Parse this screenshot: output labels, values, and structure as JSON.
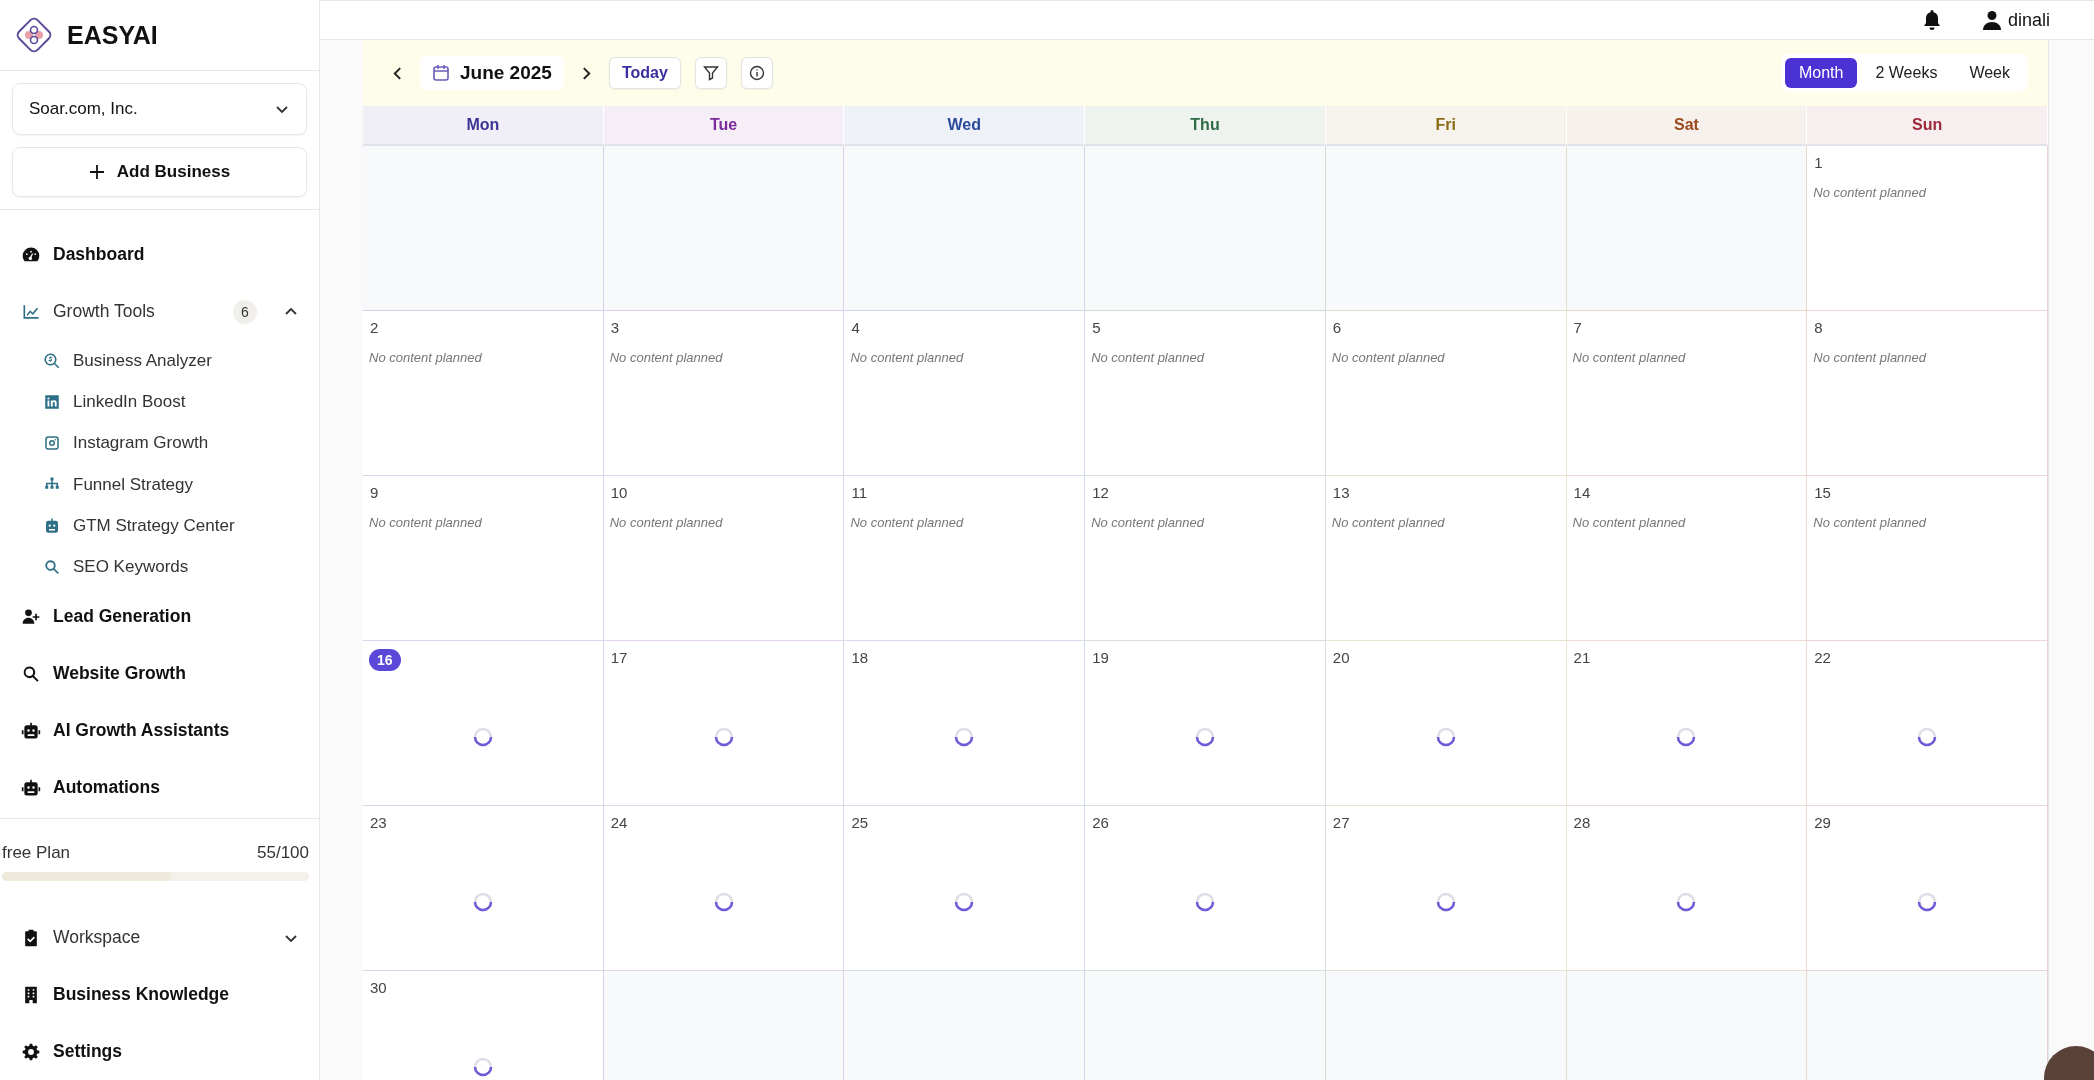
{
  "sidebar": {
    "brand": "EASYAI",
    "business_select": {
      "value": "Soar.com, Inc."
    },
    "add_button": "Add Business",
    "nav": [
      {
        "kind": "item",
        "label": "Dashboard"
      },
      {
        "kind": "group",
        "label": "Growth Tools",
        "badge": "6",
        "expanded": true,
        "children": [
          {
            "label": "Business Analyzer"
          },
          {
            "label": "LinkedIn Boost"
          },
          {
            "label": "Instagram Growth"
          },
          {
            "label": "Funnel Strategy"
          },
          {
            "label": "GTM Strategy Center"
          },
          {
            "label": "SEO Keywords"
          }
        ]
      },
      {
        "kind": "item",
        "label": "Lead Generation"
      },
      {
        "kind": "item",
        "label": "Website Growth"
      },
      {
        "kind": "item",
        "label": "AI Growth Assistants"
      },
      {
        "kind": "item",
        "label": "Automations"
      }
    ],
    "plan": {
      "name": "free Plan",
      "usage": "55/100",
      "level": 0.55
    },
    "bottom_nav": [
      {
        "kind": "group",
        "label": "Workspace",
        "expanded": false
      },
      {
        "kind": "item",
        "label": "Business Knowledge"
      },
      {
        "kind": "item",
        "label": "Settings"
      }
    ]
  },
  "topbar": {
    "user": "dinali"
  },
  "calendar": {
    "month": "June 2025",
    "today_button": "Today",
    "views": [
      {
        "label": "Month",
        "selected": true
      },
      {
        "label": "2 Weeks",
        "selected": false
      },
      {
        "label": "Week",
        "selected": false
      }
    ],
    "weekdays": [
      {
        "label": "Mon",
        "color": "#3b3494"
      },
      {
        "label": "Tue",
        "color": "#7a2a9c"
      },
      {
        "label": "Wed",
        "color": "#2a4a9a"
      },
      {
        "label": "Thu",
        "color": "#2f6b45"
      },
      {
        "label": "Fri",
        "color": "#8a6a14"
      },
      {
        "label": "Sat",
        "color": "#9a4a1e"
      },
      {
        "label": "Sun",
        "color": "#9a2a3a"
      }
    ],
    "cells": [
      {
        "kind": "empty"
      },
      {
        "kind": "empty"
      },
      {
        "kind": "empty"
      },
      {
        "kind": "empty"
      },
      {
        "kind": "empty"
      },
      {
        "kind": "empty"
      },
      {
        "kind": "planned",
        "day": "1",
        "note": "No content planned",
        "selected": false
      },
      {
        "kind": "planned",
        "day": "2",
        "note": "No content planned",
        "selected": false
      },
      {
        "kind": "planned",
        "day": "3",
        "note": "No content planned",
        "selected": false
      },
      {
        "kind": "planned",
        "day": "4",
        "note": "No content planned",
        "selected": false
      },
      {
        "kind": "planned",
        "day": "5",
        "note": "No content planned",
        "selected": false
      },
      {
        "kind": "planned",
        "day": "6",
        "note": "No content planned",
        "selected": false
      },
      {
        "kind": "planned",
        "day": "7",
        "note": "No content planned",
        "selected": false
      },
      {
        "kind": "planned",
        "day": "8",
        "note": "No content planned",
        "selected": false
      },
      {
        "kind": "planned",
        "day": "9",
        "note": "No content planned",
        "selected": false
      },
      {
        "kind": "planned",
        "day": "10",
        "note": "No content planned",
        "selected": false
      },
      {
        "kind": "planned",
        "day": "11",
        "note": "No content planned",
        "selected": false
      },
      {
        "kind": "planned",
        "day": "12",
        "note": "No content planned",
        "selected": false
      },
      {
        "kind": "planned",
        "day": "13",
        "note": "No content planned",
        "selected": false
      },
      {
        "kind": "planned",
        "day": "14",
        "note": "No content planned",
        "selected": false
      },
      {
        "kind": "planned",
        "day": "15",
        "note": "No content planned",
        "selected": false
      },
      {
        "kind": "loading",
        "day": "16",
        "selected": true
      },
      {
        "kind": "loading",
        "day": "17",
        "selected": false
      },
      {
        "kind": "loading",
        "day": "18",
        "selected": false
      },
      {
        "kind": "loading",
        "day": "19",
        "selected": false
      },
      {
        "kind": "loading",
        "day": "20",
        "selected": false
      },
      {
        "kind": "loading",
        "day": "21",
        "selected": false
      },
      {
        "kind": "loading",
        "day": "22",
        "selected": false
      },
      {
        "kind": "loading",
        "day": "23",
        "selected": false
      },
      {
        "kind": "loading",
        "day": "24",
        "selected": false
      },
      {
        "kind": "loading",
        "day": "25",
        "selected": false
      },
      {
        "kind": "loading",
        "day": "26",
        "selected": false
      },
      {
        "kind": "loading",
        "day": "27",
        "selected": false
      },
      {
        "kind": "loading",
        "day": "28",
        "selected": false
      },
      {
        "kind": "loading",
        "day": "29",
        "selected": false
      },
      {
        "kind": "loading",
        "day": "30",
        "selected": false
      },
      {
        "kind": "empty"
      },
      {
        "kind": "empty"
      },
      {
        "kind": "empty"
      },
      {
        "kind": "empty"
      },
      {
        "kind": "empty"
      },
      {
        "kind": "empty"
      }
    ]
  }
}
